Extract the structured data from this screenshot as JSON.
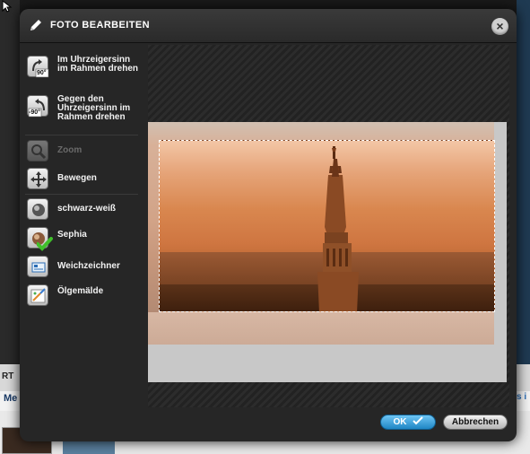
{
  "background": {
    "left_text": "RT",
    "left_text2": "Me",
    "right_link": "s i"
  },
  "modal": {
    "title": "FOTO BEARBEITEN",
    "close_label": "×"
  },
  "tools": [
    {
      "label": "Im Uhrzeigersinn im Rahmen drehen",
      "badge": "90°",
      "icon": "rotate-clockwise-icon",
      "enabled": true
    },
    {
      "label": "Gegen den Uhrzeigersinn im Rahmen drehen",
      "badge": "-90°",
      "icon": "rotate-counterclockwise-icon",
      "enabled": true
    },
    {
      "label": "Zoom",
      "icon": "zoom-icon",
      "enabled": false
    },
    {
      "label": "Bewegen",
      "icon": "move-icon",
      "enabled": true
    },
    {
      "label": "schwarz-weiß",
      "icon": "black-white-icon",
      "enabled": true
    },
    {
      "label": "Sephia",
      "icon": "sepia-icon",
      "enabled": true,
      "checked": true
    },
    {
      "label": "Weichzeichner",
      "icon": "soften-icon",
      "enabled": true
    },
    {
      "label": "Ölgemälde",
      "icon": "oil-painting-icon",
      "enabled": true
    }
  ],
  "footer": {
    "ok_label": "OK",
    "cancel_label": "Abbrechen"
  },
  "colors": {
    "accent": "#1f86c4",
    "check": "#3fbf2a",
    "sepia": "#d9874f"
  }
}
